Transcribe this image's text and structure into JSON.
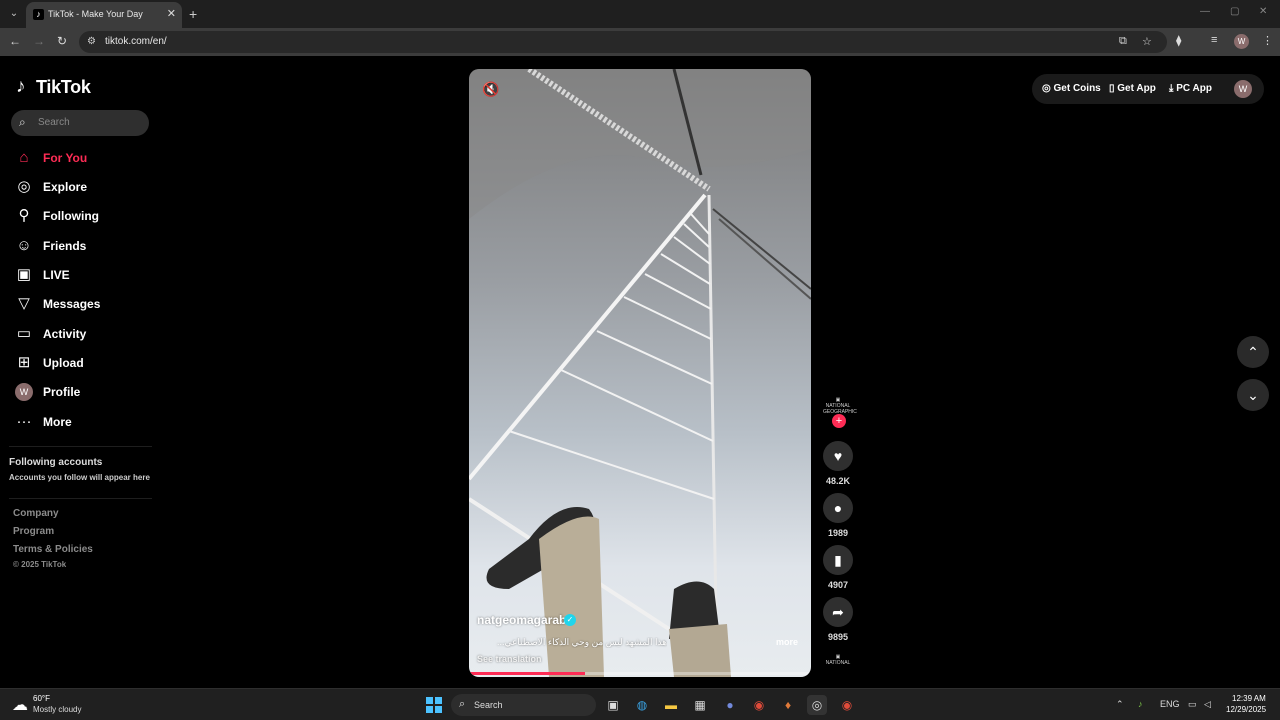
{
  "browser": {
    "tab_title": "TikTok - Make Your Day",
    "url": "tiktok.com/en/",
    "profile_initial": "W"
  },
  "brand": {
    "name": "TikTok"
  },
  "search": {
    "placeholder": "Search"
  },
  "nav": [
    {
      "label": "For You",
      "icon": "home-icon",
      "active": true
    },
    {
      "label": "Explore",
      "icon": "compass-icon"
    },
    {
      "label": "Following",
      "icon": "following-icon"
    },
    {
      "label": "Friends",
      "icon": "friends-icon"
    },
    {
      "label": "LIVE",
      "icon": "live-icon"
    },
    {
      "label": "Messages",
      "icon": "messages-icon"
    },
    {
      "label": "Activity",
      "icon": "activity-icon"
    },
    {
      "label": "Upload",
      "icon": "upload-icon"
    },
    {
      "label": "Profile",
      "icon": "profile-avatar",
      "initial": "W"
    },
    {
      "label": "More",
      "icon": "more-icon"
    }
  ],
  "following_accounts": {
    "title": "Following accounts",
    "subtitle": "Accounts you follow will appear here"
  },
  "footer": {
    "links": [
      "Company",
      "Program",
      "Terms & Policies"
    ],
    "copyright": "© 2025 TikTok"
  },
  "video": {
    "username": "natgeomagarab",
    "caption": "هذا المشهد ليس من وحي الذكاء الاصطناعي...",
    "more_label": "more",
    "see_translation": "See translation",
    "progress": 0.34
  },
  "actions": {
    "likes": "48.2K",
    "comments": "1989",
    "saves": "4907",
    "shares": "9895"
  },
  "top_right": {
    "get_coins": "Get Coins",
    "get_app": "Get App",
    "pc_app": "PC App",
    "avatar_initial": "W"
  },
  "taskbar": {
    "temperature": "60°F",
    "weather": "Mostly cloudy",
    "search": "Search",
    "lang": "ENG",
    "time": "12:39 AM",
    "date": "12/29/2025"
  },
  "colors": {
    "accent": "#fe2c55",
    "verified": "#20d5ec"
  }
}
